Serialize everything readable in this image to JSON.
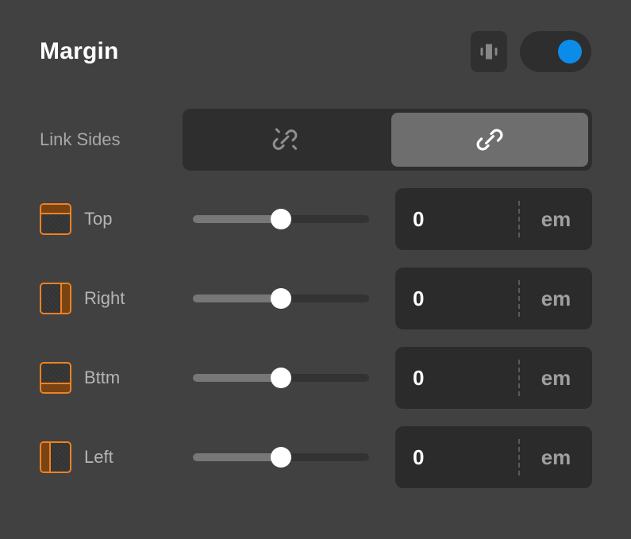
{
  "header": {
    "title": "Margin",
    "spacing_icon": "margin-box-icon",
    "toggle": {
      "state": "on",
      "accent_color": "#0c8ce9"
    }
  },
  "link_sides": {
    "label": "Link Sides",
    "options": [
      {
        "id": "unlinked",
        "icon": "broken-link-icon",
        "selected": false
      },
      {
        "id": "linked",
        "icon": "link-icon",
        "selected": true
      }
    ]
  },
  "sides": [
    {
      "id": "top",
      "label": "Top",
      "icon": "margin-top-icon",
      "slider": {
        "percent": 50
      },
      "value": "0",
      "unit": "em"
    },
    {
      "id": "right",
      "label": "Right",
      "icon": "margin-right-icon",
      "slider": {
        "percent": 50
      },
      "value": "0",
      "unit": "em"
    },
    {
      "id": "bottom",
      "label": "Bttm",
      "icon": "margin-bottom-icon",
      "slider": {
        "percent": 50
      },
      "value": "0",
      "unit": "em"
    },
    {
      "id": "left",
      "label": "Left",
      "icon": "margin-left-icon",
      "slider": {
        "percent": 50
      },
      "value": "0",
      "unit": "em"
    }
  ],
  "colors": {
    "background": "#414141",
    "accent_orange": "#f08123",
    "accent_blue": "#0c8ce9",
    "field_background": "#2b2b2b",
    "active_segment": "#6e6e6e"
  }
}
